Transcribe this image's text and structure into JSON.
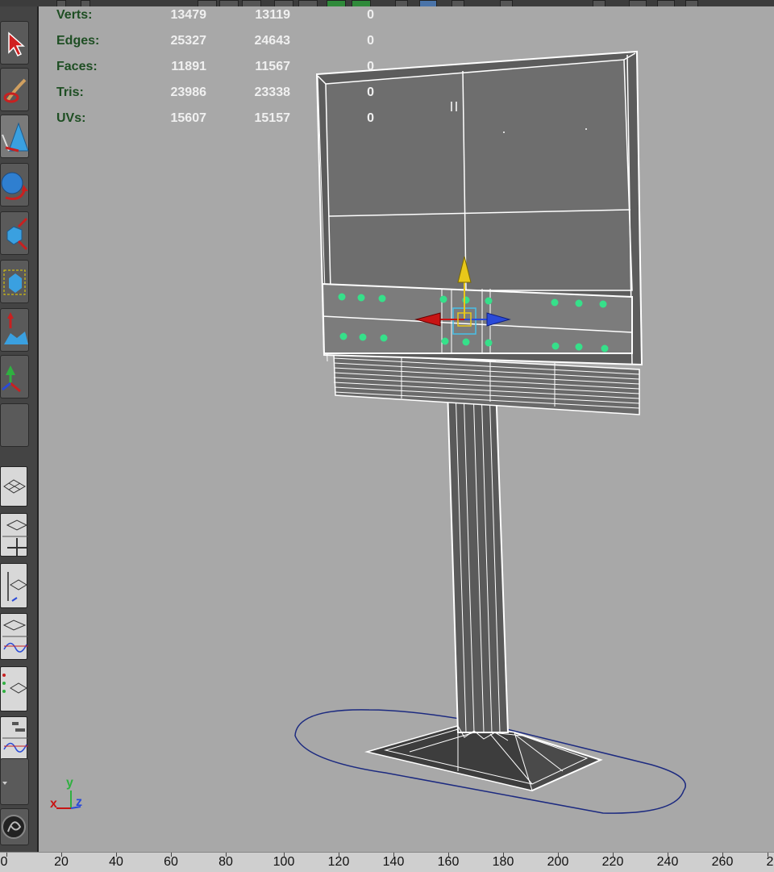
{
  "hud": {
    "rows": [
      {
        "label": "Verts:",
        "v1": "13479",
        "v2": "13119",
        "v3": "0"
      },
      {
        "label": "Edges:",
        "v1": "25327",
        "v2": "24643",
        "v3": "0"
      },
      {
        "label": "Faces:",
        "v1": "11891",
        "v2": "11567",
        "v3": "0"
      },
      {
        "label": "Tris:",
        "v1": "23986",
        "v2": "23338",
        "v3": "0"
      },
      {
        "label": "UVs:",
        "v1": "15607",
        "v2": "15157",
        "v3": "0"
      }
    ]
  },
  "axis": {
    "x": "x",
    "y": "y",
    "z": "z"
  },
  "timeline": {
    "ticks": [
      "0",
      "20",
      "40",
      "60",
      "80",
      "100",
      "120",
      "140",
      "160",
      "180",
      "200",
      "220",
      "240",
      "260",
      "2"
    ]
  },
  "colors": {
    "viewport_bg": "#a8a8a8",
    "hud_label": "#1e4e23",
    "hud_value": "#f0f0f0",
    "wire": "#ffffff",
    "selected_vertex": "#36e08a",
    "manip_x": "#c81414",
    "manip_y": "#e8c81a",
    "manip_z": "#2a4ad8",
    "ground_curve": "#1c2a80"
  },
  "toolbox": {
    "tools": [
      "select-tool-icon",
      "paint-select-icon",
      "lasso-icon",
      "move-tool-icon",
      "rotate-tool-icon",
      "scale-tool-icon",
      "universal-manip-icon",
      "soft-mod-icon",
      "show-manip-icon",
      "last-tool-icon"
    ],
    "layouts": [
      "single-perspective-layout-icon",
      "four-view-layout-icon",
      "persp-outliner-layout-icon",
      "persp-graph-layout-icon",
      "hypershade-layout-icon",
      "persp-graph-outliner-layout-icon",
      "settings-icon"
    ]
  }
}
